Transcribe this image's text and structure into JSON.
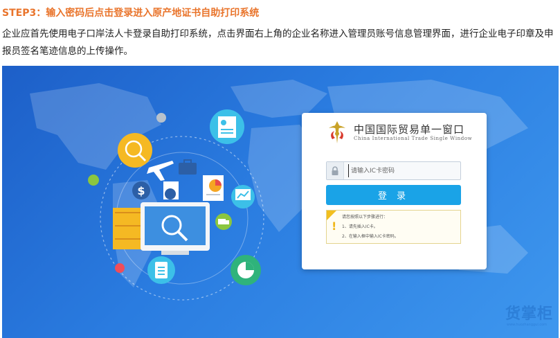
{
  "article": {
    "step_title": "STEP3：输入密码后点击登录进入原产地证书自助打印系统",
    "intro": "企业应首先使用电子口岸法人卡登录自助打印系统，点击界面右上角的企业名称进入管理员账号信息管理界面，进行企业电子印章及申报员签名笔迹信息的上传操作。"
  },
  "login": {
    "brand_cn": "中国国际贸易单一窗口",
    "brand_en": "China International Trade Single Window",
    "password_placeholder": "请输入IC卡密码",
    "password_value": "",
    "login_label": "登 录",
    "notice_title": "请您按照以下步骤进行：",
    "notice_step1": "1、请先插入IC卡。",
    "notice_step2": "2、在输入框中输入IC卡密码。"
  },
  "icons": {
    "lock": "lock-icon",
    "warning": "warning-icon",
    "logo": "customs-emblem-icon"
  },
  "colors": {
    "step_title": "#e9742b",
    "login_button": "#1aa3e7",
    "background_blue": "#2a7ce0"
  },
  "watermark": {
    "text": "货掌柜",
    "url": "www.huozhanggui.com"
  }
}
